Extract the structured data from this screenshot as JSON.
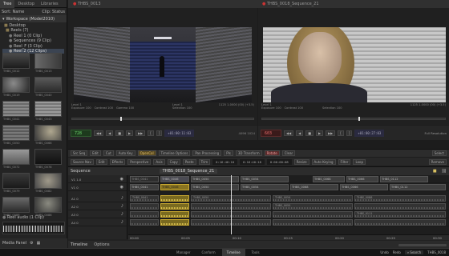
{
  "left_panel": {
    "tabs": [
      "Tree",
      "Desktop",
      "Libraries"
    ],
    "sort_label": "Sort: Name",
    "clip_status": "Clip: Status",
    "workspace_label": "Workspace (Model2010)",
    "tree": [
      "Desktop",
      "Reels (7)",
      "Reel 1 (0 Clip)",
      "Sequences (9 Clip)",
      "Reel_F (3 Clip)",
      "Reel 2 (12 Clips)"
    ],
    "bottom_tree": [
      "Reel audio (1 Clip)"
    ],
    "thumbs": [
      [
        "THBS_0012",
        "THBS_0013"
      ],
      [
        "THBS_0019",
        "THBS_0040"
      ],
      [
        "THBS_0041",
        "THBS_0043"
      ],
      [
        "THBS_0050",
        "THBS_0066"
      ],
      [
        "THBS_0072",
        "THBS_0078"
      ],
      [
        "THBS_0079",
        "THBS_0082"
      ],
      [
        "THBS_0086",
        "THBS_0088"
      ]
    ],
    "bottom_icons": [
      "Media Panel"
    ]
  },
  "viewer_left": {
    "tab": "THBS_0013",
    "info_line1": "Level 1",
    "info_line2": "Exposure 100",
    "info_line3": "Contrast 100",
    "info_line4": "Gamma 100",
    "info_right": "Level 1",
    "info_right2": "Selection 100",
    "tc_label": "1125 1-0000 (00) (+3.5)",
    "timecode": "728",
    "timecode2": "+01:00:11:03",
    "res": "4096 1024"
  },
  "viewer_right": {
    "tab": "THBS_0018_Sequence_21",
    "info_line1": "Level 1",
    "info_line2": "Exposure 100",
    "info_line3": "Contrast 100",
    "info_right": "Selection 100",
    "tc_label": "1125 1-0000 (00) (+3.5)",
    "timecode": "603",
    "timecode2": "+01:00:27:03",
    "full_res": "Full Resolution",
    "options": "Options"
  },
  "toolbar1": {
    "items": [
      "Src Seq",
      "Edit",
      "Cut",
      "Auto Key",
      "OpenCol",
      "Timeline Options",
      "Pan Processing",
      "Pls",
      "3D Transform",
      "Rotate",
      "Clear"
    ],
    "select": "Select"
  },
  "toolbar2": {
    "items": [
      "Source Nav",
      "Edit",
      "Effects",
      "Perspective",
      "Axis",
      "Copy",
      "Paste",
      "Trim",
      "Resize",
      "Filter",
      "Loop",
      "Remove"
    ],
    "in_tc": "0:16:40:10",
    "out_tc": "0:16:40:18",
    "dur_tc": "0:00:00:08",
    "range": "Auto Keying"
  },
  "timeline": {
    "header_tab": "Sequence",
    "seq_name": "THBS_0018_Sequence_21",
    "video_track_labels": [
      "V1 1.0",
      "V1 0"
    ],
    "audio_track_labels": [
      "A1 0",
      "A2 0",
      "A3 0",
      "A4 0"
    ],
    "video_clips": [
      {
        "name": "THBS_0041",
        "type": "dim"
      },
      {
        "name": "THBS_0046",
        "type": "normal"
      },
      {
        "name": "THBS_0050",
        "type": "normal"
      },
      {
        "name": "THBS_0054",
        "type": "normal"
      },
      {
        "name": "THBS_0068",
        "type": "normal"
      },
      {
        "name": "THBS_0066",
        "type": "normal"
      },
      {
        "name": "THBS_0112",
        "type": "normal"
      }
    ],
    "video_clips_row2": [
      {
        "name": "THBS_0041"
      },
      {
        "name": "THBS_0046"
      },
      {
        "name": "THBS_0050"
      },
      {
        "name": "THBS_0054"
      },
      {
        "name": "THBS_0068"
      },
      {
        "name": "THBS_0066"
      },
      {
        "name": "THBS_0112"
      }
    ],
    "audio_clips": [
      {
        "name": "THBS_0041"
      },
      {
        "name": "THBS_0050"
      },
      {
        "name": "THBS_0054"
      },
      {
        "name": "THBS_0055"
      },
      {
        "name": "THBS_0088"
      },
      {
        "name": "THBS_0111"
      }
    ],
    "ruler": [
      "00:00",
      "00:05",
      "00:10",
      "00:15",
      "00:20",
      "00:25",
      "00:30"
    ],
    "bottom_tabs": [
      "Timeline",
      "Options"
    ]
  },
  "statusbar": {
    "tabs": [
      "Manager",
      "Conform",
      "Timeline",
      "Tools"
    ],
    "right": [
      "Undo",
      "Redo",
      "Search",
      "THBS_0018"
    ]
  }
}
